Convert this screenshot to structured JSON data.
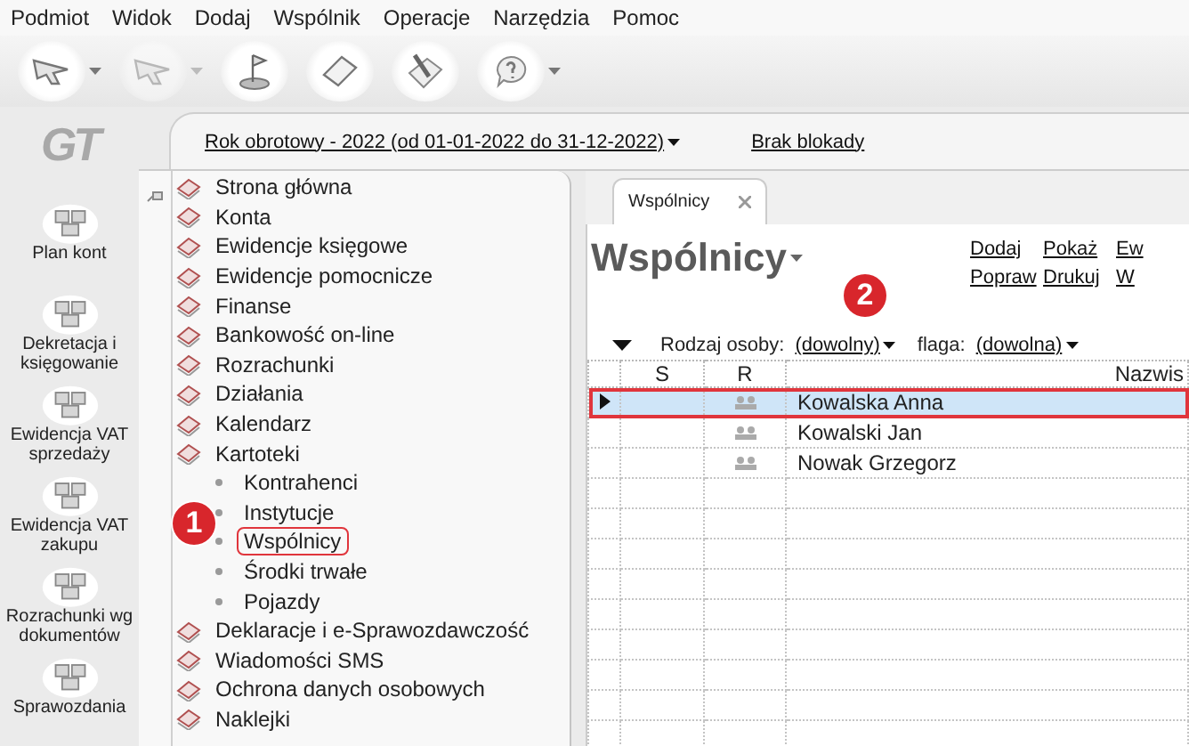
{
  "menu": [
    "Podmiot",
    "Widok",
    "Dodaj",
    "Wspólnik",
    "Operacje",
    "Narzędzia",
    "Pomoc"
  ],
  "toolbar": [
    {
      "kind": "arrow",
      "dropdown": true,
      "disabled": false
    },
    {
      "kind": "arrow",
      "dropdown": true,
      "disabled": true
    },
    {
      "kind": "flag",
      "dropdown": false,
      "disabled": false
    },
    {
      "kind": "paper",
      "dropdown": false,
      "disabled": false
    },
    {
      "kind": "brush",
      "dropdown": false,
      "disabled": false
    },
    {
      "kind": "help",
      "dropdown": true,
      "disabled": false
    }
  ],
  "logo": "GT",
  "sidebar": [
    {
      "label": "Plan kont"
    },
    {
      "label": "Dekretacja i\nksięgowanie"
    },
    {
      "label": "Ewidencja VAT\nsprzedaży"
    },
    {
      "label": "Ewidencja VAT\nzakupu"
    },
    {
      "label": "Rozrachunki wg\ndokumentów"
    },
    {
      "label": "Sprawozdania"
    }
  ],
  "period": {
    "label": "Rok obrotowy - 2022  (od 01-01-2022 do 31-12-2022)",
    "lock": "Brak blokady"
  },
  "tree": [
    {
      "label": "Strona główna",
      "selected": false
    },
    {
      "label": "Konta",
      "selected": false
    },
    {
      "label": "Ewidencje księgowe",
      "selected": false
    },
    {
      "label": "Ewidencje pomocnicze",
      "selected": false
    },
    {
      "label": "Finanse",
      "selected": false
    },
    {
      "label": "Bankowość on-line",
      "selected": false
    },
    {
      "label": "Rozrachunki",
      "selected": false
    },
    {
      "label": "Działania",
      "selected": false
    },
    {
      "label": "Kalendarz",
      "selected": false
    },
    {
      "label": "Kartoteki",
      "selected": false,
      "children": [
        {
          "label": "Kontrahenci",
          "selected": false
        },
        {
          "label": "Instytucje",
          "selected": false
        },
        {
          "label": "Wspólnicy",
          "selected": true
        },
        {
          "label": "Środki trwałe",
          "selected": false
        },
        {
          "label": "Pojazdy",
          "selected": false
        }
      ]
    },
    {
      "label": "Deklaracje i e-Sprawozdawczość",
      "selected": false
    },
    {
      "label": "Wiadomości SMS",
      "selected": false
    },
    {
      "label": "Ochrona danych osobowych",
      "selected": false
    },
    {
      "label": "Naklejki",
      "selected": false
    }
  ],
  "tab": {
    "label": "Wspólnicy"
  },
  "title": "Wspólnicy",
  "actions": [
    [
      "Dodaj",
      "Popraw"
    ],
    [
      "Pokaż",
      "Drukuj"
    ],
    [
      "Ew",
      "W"
    ]
  ],
  "filters": [
    {
      "label": "Rodzaj osoby:",
      "value": "(dowolny)"
    },
    {
      "label": "flaga:",
      "value": "(dowolna)"
    }
  ],
  "grid": {
    "columns": [
      "S",
      "R",
      "Nazwis"
    ],
    "rows": [
      {
        "name": "Kowalska Anna",
        "selected": true
      },
      {
        "name": "Kowalski Jan",
        "selected": false
      },
      {
        "name": "Nowak Grzegorz",
        "selected": false
      }
    ]
  },
  "badges": [
    "1",
    "2"
  ]
}
